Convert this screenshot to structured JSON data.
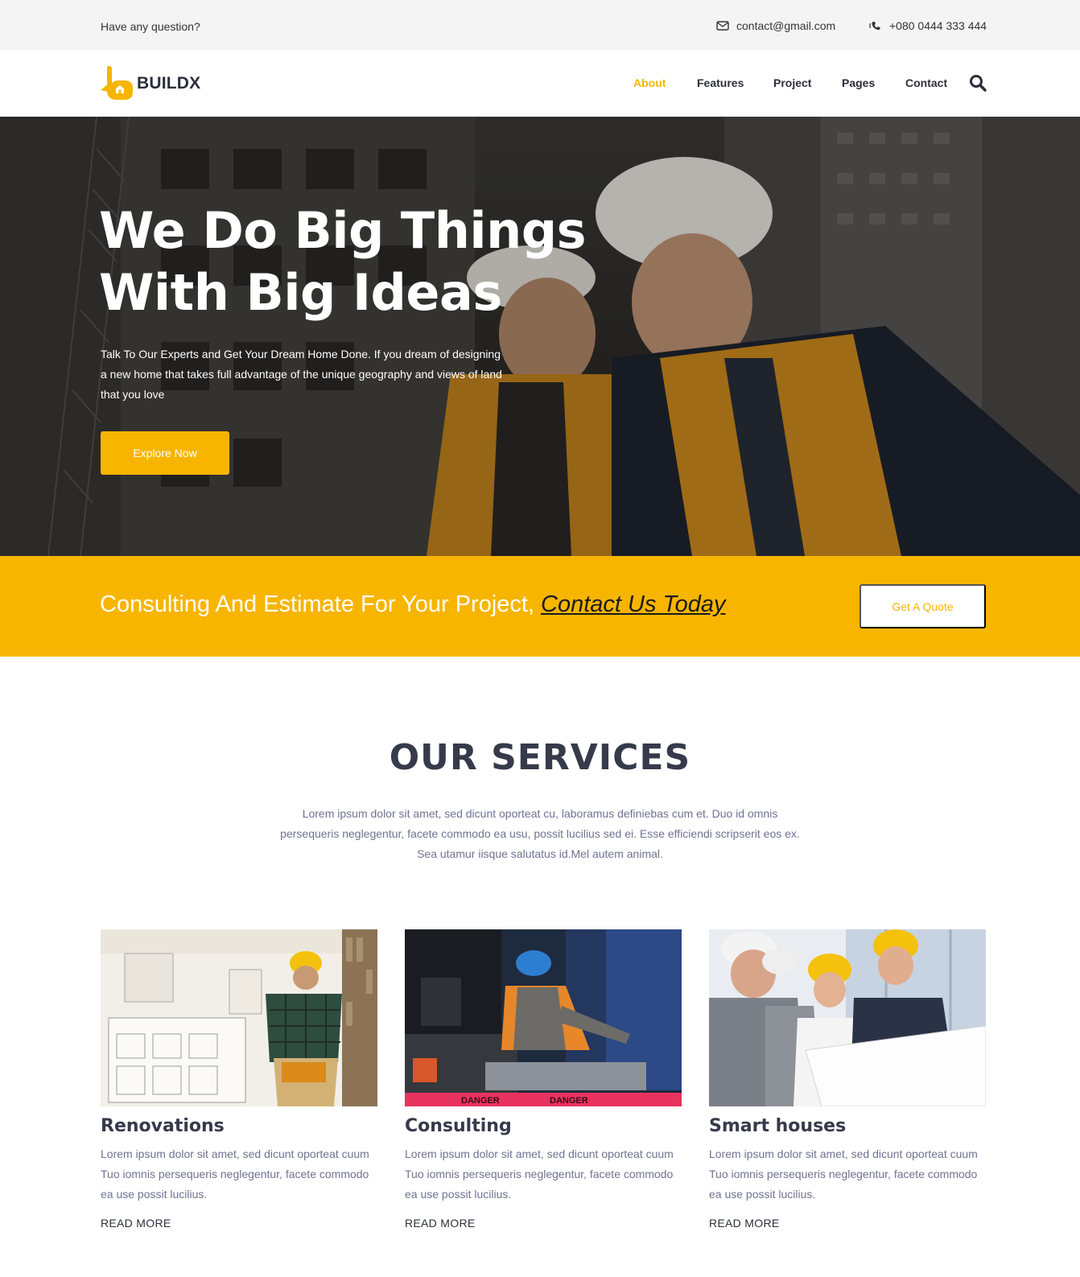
{
  "topbar": {
    "question": "Have any question?",
    "email": "contact@gmail.com",
    "phone": "+080 0444 333 444"
  },
  "header": {
    "logo_text": "BUILDX",
    "nav": [
      "About",
      "Features",
      "Project",
      "Pages",
      "Contact"
    ],
    "active_nav": "About"
  },
  "hero": {
    "title_line1": "We Do Big Things",
    "title_line2": "With Big Ideas",
    "description": "Talk To Our Experts and Get Your Dream Home Done. If you dream of designing a new home that takes full advantage of the unique geography and views of land that you love",
    "cta_label": "Explore Now"
  },
  "band": {
    "text": "Consulting And Estimate For Your Project,",
    "link": "Contact Us Today",
    "button_label": "Get A Quote"
  },
  "services": {
    "title": "OUR SERVICES",
    "description": "Lorem ipsum dolor sit amet, sed dicunt oporteat cu, laboramus definiebas cum et. Duo id omnis persequeris neglegentur, facete commodo ea usu, possit lucilius sed ei. Esse efficiendi scripserit eos ex. Sea utamur iisque salutatus id.Mel autem animal.",
    "cards": [
      {
        "title": "Renovations",
        "text": "Lorem ipsum dolor sit amet, sed dicunt oporteat cuum Tuo iomnis persequeris neglegentur, facete commodo ea use possit lucilius.",
        "link": "READ MORE"
      },
      {
        "title": "Consulting",
        "text": "Lorem ipsum dolor sit amet, sed dicunt oporteat cuum Tuo iomnis persequeris neglegentur, facete commodo ea use possit lucilius.",
        "link": "READ MORE"
      },
      {
        "title": "Smart houses",
        "text": "Lorem ipsum dolor sit amet, sed dicunt oporteat cuum Tuo iomnis persequeris neglegentur, facete commodo ea use possit lucilius.",
        "link": "READ MORE"
      }
    ],
    "image_signs": [
      "DANGER",
      "DANGER"
    ]
  },
  "colors": {
    "accent": "#f7b500",
    "heading": "#363a4a",
    "body_text": "#6e7391",
    "topbar_bg": "#f4f4f4"
  },
  "icons": [
    "envelope-icon",
    "phone-icon",
    "search-icon",
    "logo-icon"
  ]
}
